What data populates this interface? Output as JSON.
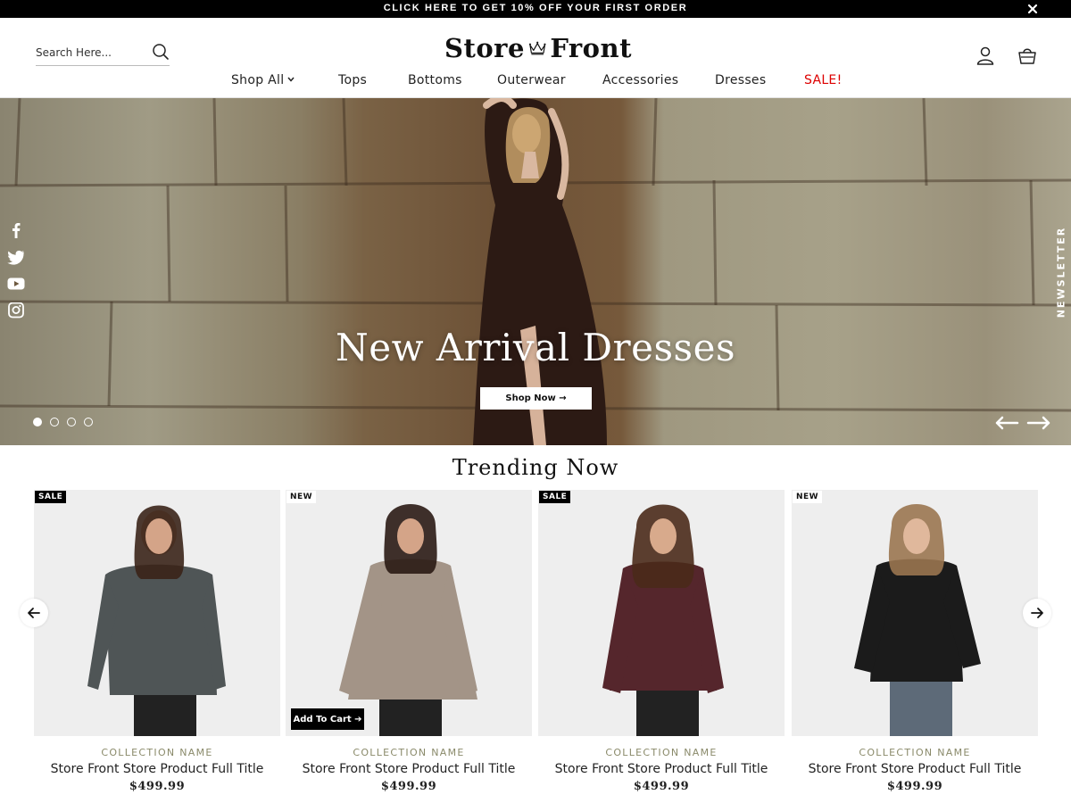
{
  "promo": {
    "text": "CLICK HERE TO GET 10% OFF YOUR FIRST ORDER"
  },
  "header": {
    "search_placeholder": "Search Here...",
    "logo_left": "Store",
    "logo_right": "Front",
    "nav": [
      "Shop All",
      "Tops",
      "Bottoms",
      "Outerwear",
      "Accessories",
      "Dresses",
      "SALE!"
    ]
  },
  "hero": {
    "title": "New Arrival Dresses",
    "button_label": "Shop Now →",
    "slide_count": 4,
    "active_slide": 1,
    "newsletter_label": "NEWSLETTER"
  },
  "trending": {
    "title": "Trending Now",
    "add_to_cart_label": "Add To Cart ➔",
    "products": [
      {
        "badge": "SALE",
        "collection": "COLLECTION NAME",
        "title": "Store Front Store Product Full Title",
        "price": "$499.99",
        "top_color": "#4f5556"
      },
      {
        "badge": "NEW",
        "collection": "COLLECTION NAME",
        "title": "Store Front Store Product Full Title",
        "price": "$499.99",
        "top_color": "#a39487"
      },
      {
        "badge": "SALE",
        "collection": "COLLECTION NAME",
        "title": "Store Front Store Product Full Title",
        "price": "$499.99",
        "top_color": "#55262c"
      },
      {
        "badge": "NEW",
        "collection": "COLLECTION NAME",
        "title": "Store Front Store Product Full Title",
        "price": "$499.99",
        "top_color": "#1b1b1b"
      }
    ]
  },
  "colors": {
    "sale_red": "#dd0000",
    "promo_bg": "#000000",
    "card_bg": "#eeeeee",
    "collection_text": "#8a8a6a"
  }
}
